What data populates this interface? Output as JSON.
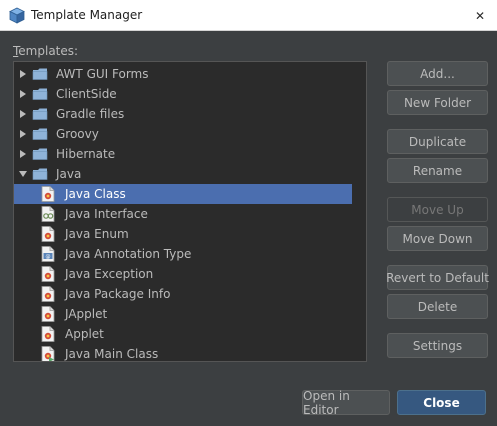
{
  "window": {
    "title": "Template Manager",
    "close_glyph": "✕"
  },
  "templates": {
    "label": "Templates:",
    "tree": [
      {
        "label": "AWT GUI Forms",
        "type": "folder",
        "expanded": false
      },
      {
        "label": "ClientSide",
        "type": "folder",
        "expanded": false
      },
      {
        "label": "Gradle files",
        "type": "folder",
        "expanded": false
      },
      {
        "label": "Groovy",
        "type": "folder",
        "expanded": false
      },
      {
        "label": "Hibernate",
        "type": "folder",
        "expanded": false
      },
      {
        "label": "Java",
        "type": "folder",
        "expanded": true
      },
      {
        "label": "Java Class",
        "type": "file",
        "icon": "java-class-icon",
        "selected": true
      },
      {
        "label": "Java Interface",
        "type": "file",
        "icon": "java-interface-icon"
      },
      {
        "label": "Java Enum",
        "type": "file",
        "icon": "java-enum-icon"
      },
      {
        "label": "Java Annotation Type",
        "type": "file",
        "icon": "java-annotation-icon"
      },
      {
        "label": "Java Exception",
        "type": "file",
        "icon": "java-exception-icon"
      },
      {
        "label": "Java Package Info",
        "type": "file",
        "icon": "java-package-info-icon"
      },
      {
        "label": "JApplet",
        "type": "file",
        "icon": "japplet-icon"
      },
      {
        "label": "Applet",
        "type": "file",
        "icon": "applet-icon"
      },
      {
        "label": "Java Main Class",
        "type": "file",
        "icon": "java-main-class-icon"
      }
    ]
  },
  "actions": {
    "add": "Add...",
    "new_folder": "New Folder",
    "duplicate": "Duplicate",
    "rename": "Rename",
    "move_up": "Move Up",
    "move_down": "Move Down",
    "revert": "Revert to Default",
    "delete": "Delete",
    "settings": "Settings"
  },
  "footer": {
    "open_in_editor": "Open in Editor",
    "close": "Close"
  },
  "colors": {
    "background": "#3c3f41",
    "tree_background": "#2b2b2b",
    "selection": "#4b6eaf",
    "folder": "#8fb3d8",
    "primary_button": "#365880"
  }
}
